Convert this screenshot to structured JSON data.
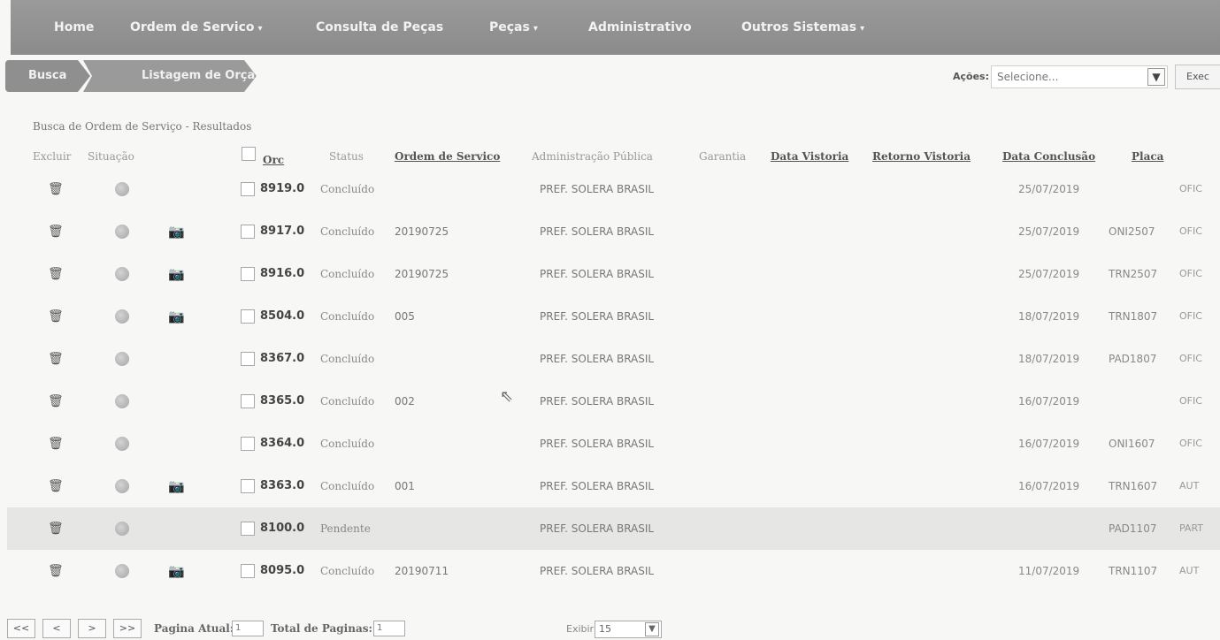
{
  "nav": {
    "home": "Home",
    "ordem": "Ordem de Servico",
    "consulta": "Consulta de Peças",
    "pecas": "Peças",
    "admin": "Administrativo",
    "outros": "Outros Sistemas"
  },
  "breadcrumb": {
    "busca": "Busca",
    "listagem": "Listagem de Orçamentos"
  },
  "acoes": {
    "label": "Ações:",
    "placeholder": "Selecione...",
    "exec_label": "Exec"
  },
  "results_title": "Busca de Ordem de Serviço - Resultados",
  "columns": {
    "excluir": "Excluir",
    "situacao": "Situação",
    "orc": "Orc",
    "status": "Status",
    "ordem": "Ordem de Servico",
    "adm": "Administração Pública",
    "garantia": "Garantia",
    "data_vistoria": "Data Vistoria",
    "retorno_vistoria": "Retorno Vistoria",
    "data_conclusao": "Data Conclusão",
    "placa": "Placa"
  },
  "rows": [
    {
      "orc": "8919.0",
      "status": "Concluído",
      "os": "",
      "adm": "PREF. SOLERA BRASIL",
      "data_conclusao": "25/07/2019",
      "placa": "",
      "extra": "OFIC",
      "photo": false
    },
    {
      "orc": "8917.0",
      "status": "Concluído",
      "os": "20190725",
      "adm": "PREF. SOLERA BRASIL",
      "data_conclusao": "25/07/2019",
      "placa": "ONI2507",
      "extra": "OFIC",
      "photo": true
    },
    {
      "orc": "8916.0",
      "status": "Concluído",
      "os": "20190725",
      "adm": "PREF. SOLERA BRASIL",
      "data_conclusao": "25/07/2019",
      "placa": "TRN2507",
      "extra": "OFIC",
      "photo": true
    },
    {
      "orc": "8504.0",
      "status": "Concluído",
      "os": "005",
      "adm": "PREF. SOLERA BRASIL",
      "data_conclusao": "18/07/2019",
      "placa": "TRN1807",
      "extra": "OFIC",
      "photo": true
    },
    {
      "orc": "8367.0",
      "status": "Concluído",
      "os": "",
      "adm": "PREF. SOLERA BRASIL",
      "data_conclusao": "18/07/2019",
      "placa": "PAD1807",
      "extra": "OFIC",
      "photo": false
    },
    {
      "orc": "8365.0",
      "status": "Concluído",
      "os": "002",
      "adm": "PREF. SOLERA BRASIL",
      "data_conclusao": "16/07/2019",
      "placa": "",
      "extra": "OFIC",
      "photo": false
    },
    {
      "orc": "8364.0",
      "status": "Concluído",
      "os": "",
      "adm": "PREF. SOLERA BRASIL",
      "data_conclusao": "16/07/2019",
      "placa": "ONI1607",
      "extra": "OFIC",
      "photo": false
    },
    {
      "orc": "8363.0",
      "status": "Concluído",
      "os": "001",
      "adm": "PREF. SOLERA BRASIL",
      "data_conclusao": "16/07/2019",
      "placa": "TRN1607",
      "extra": "AUT",
      "photo": true
    },
    {
      "orc": "8100.0",
      "status": "Pendente",
      "os": "",
      "adm": "PREF. SOLERA BRASIL",
      "data_conclusao": "",
      "placa": "PAD1107",
      "extra": "PART",
      "photo": false
    },
    {
      "orc": "8095.0",
      "status": "Concluído",
      "os": "20190711",
      "adm": "PREF. SOLERA BRASIL",
      "data_conclusao": "11/07/2019",
      "placa": "TRN1107",
      "extra": "AUT",
      "photo": true
    }
  ],
  "pager": {
    "first": "<<",
    "prev": "<",
    "next": ">",
    "last": ">>",
    "pagina_label": "Pagina Atual:",
    "pagina_value": "1",
    "total_label": "Total de Paginas:",
    "total_value": "1",
    "exibir_label": "Exibir:",
    "exibir_value": "15"
  },
  "icons": {
    "trash": "trash-icon",
    "status": "status-dot-icon",
    "camera": "camera-icon"
  }
}
